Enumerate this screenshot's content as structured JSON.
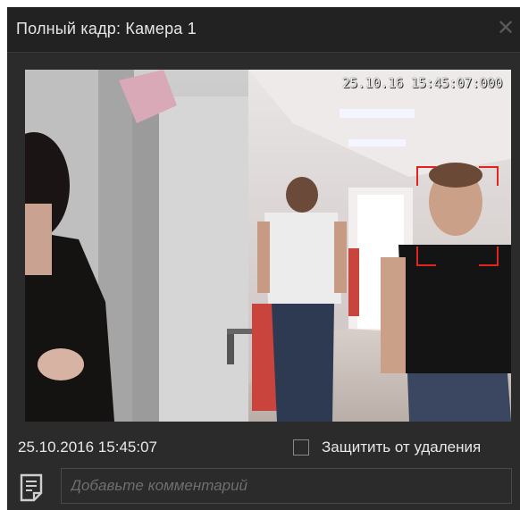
{
  "window": {
    "title": "Полный кадр:  Камера 1",
    "close_icon": "close-icon"
  },
  "frame": {
    "overlay_timestamp": "25.10.16 15:45:07:000",
    "face_box_color": "#e0241f"
  },
  "footer": {
    "timestamp": "25.10.2016 15:45:07",
    "protect_label": "Защитить от удаления",
    "protect_checked": false,
    "comment_icon": "note-icon",
    "comment_placeholder": "Добавьте комментарий",
    "comment_value": ""
  },
  "colors": {
    "background": "#2b2b2b",
    "titlebar": "#222222",
    "text": "#e8e8e8"
  }
}
